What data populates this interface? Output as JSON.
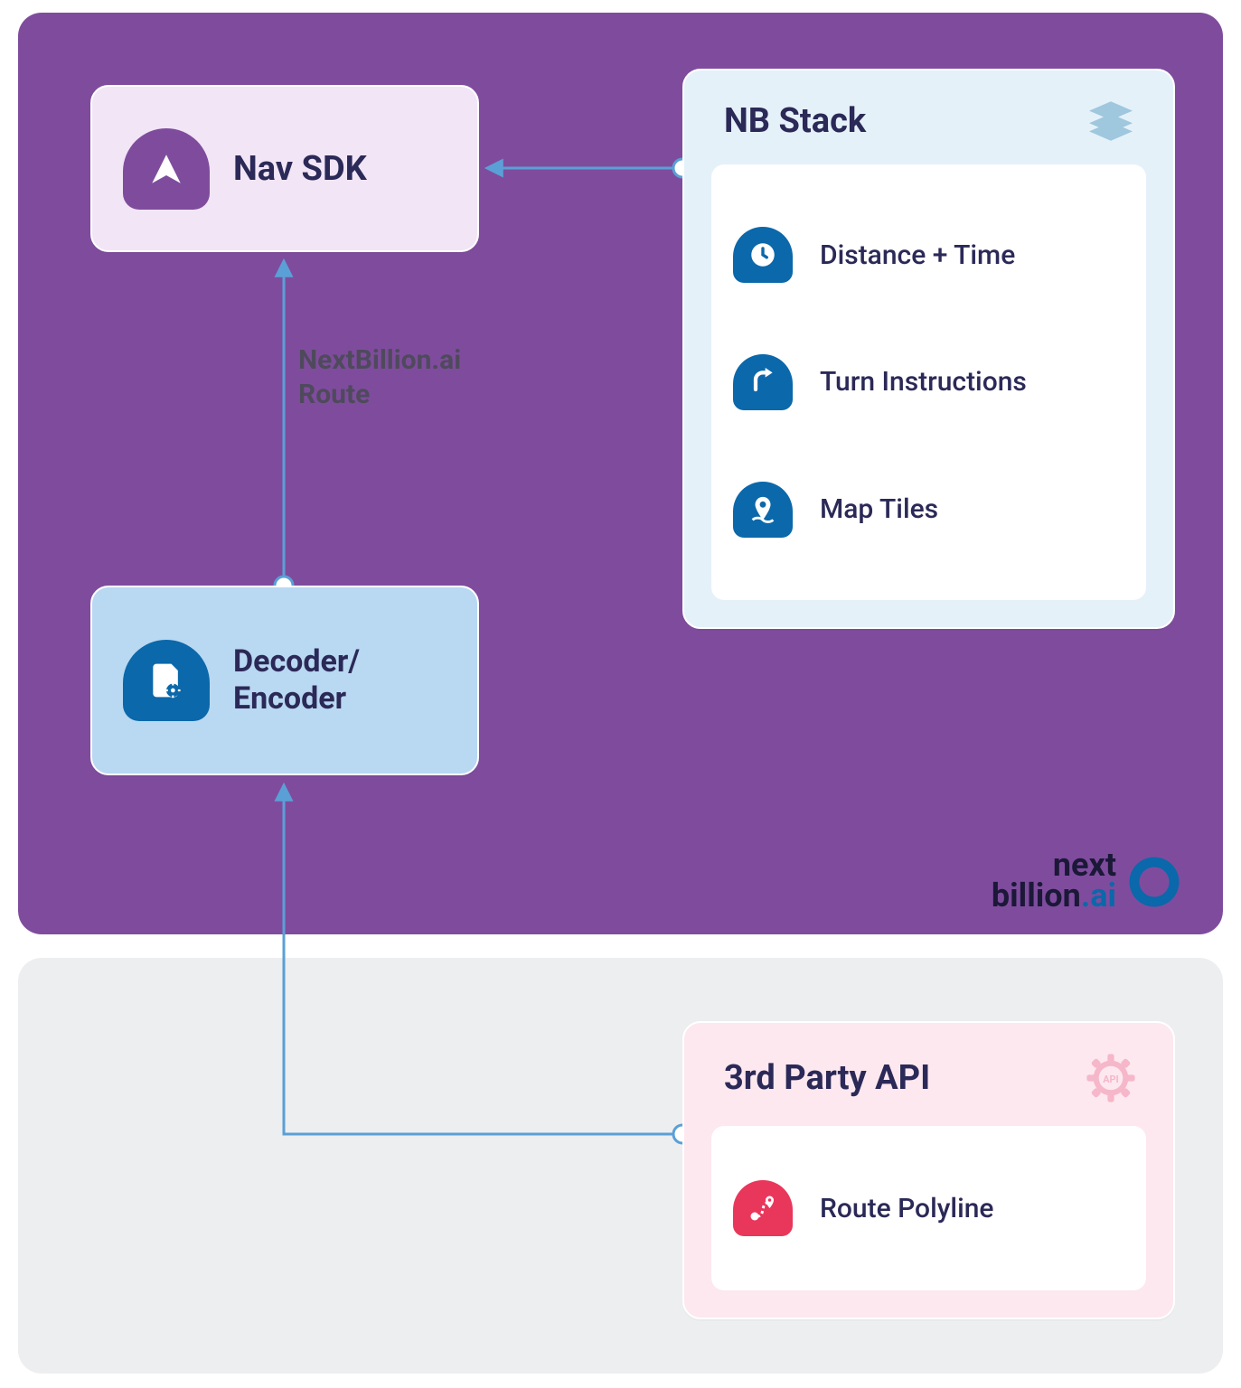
{
  "diagram": {
    "nav_sdk": {
      "title": "Nav SDK"
    },
    "decoder": {
      "title": "Decoder/\nEncoder"
    },
    "edge_label": "NextBillion.ai\nRoute",
    "nb_stack": {
      "title": "NB Stack",
      "items": [
        {
          "label": "Distance + Time"
        },
        {
          "label": "Turn Instructions"
        },
        {
          "label": "Map Tiles"
        }
      ]
    },
    "third_party": {
      "title": "3rd Party API",
      "items": [
        {
          "label": "Route Polyline"
        }
      ]
    },
    "logo": {
      "line1": "next",
      "line2": "billion",
      "suffix": ".ai"
    }
  }
}
